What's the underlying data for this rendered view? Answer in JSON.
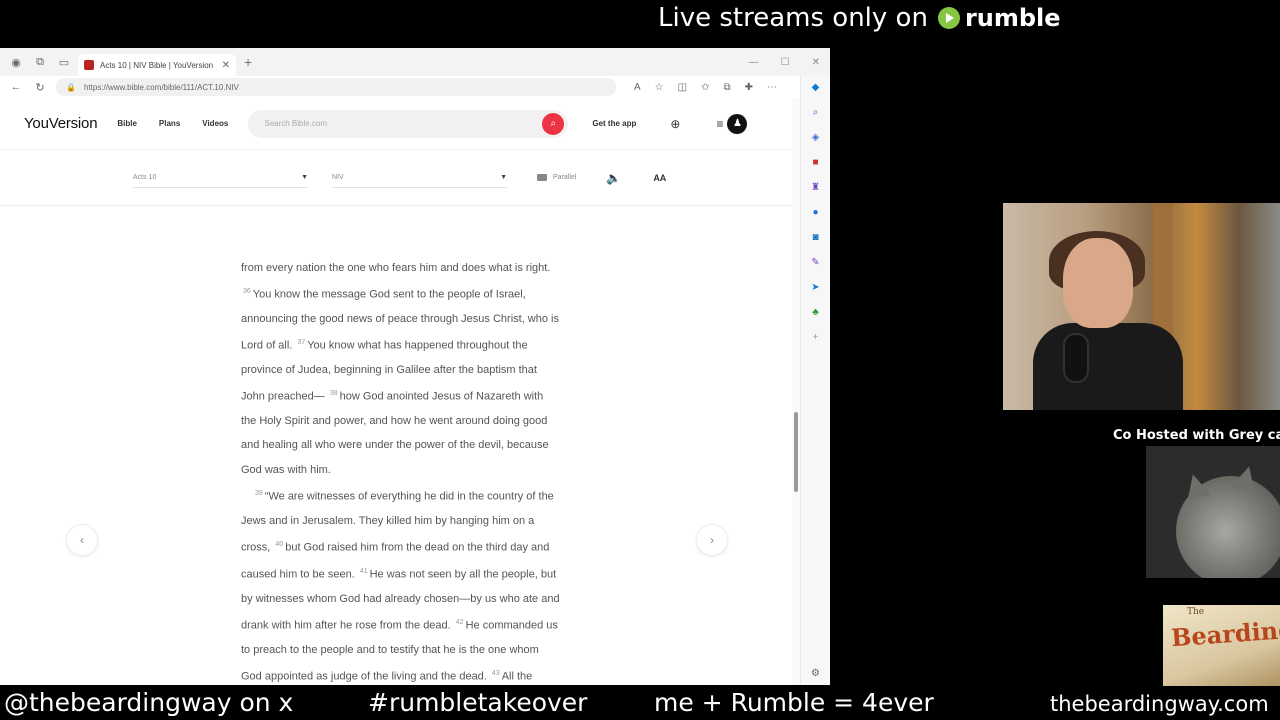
{
  "overlay": {
    "top_text": "Live streams only on",
    "rumble_word": "rumble",
    "cohost_label": "Co Hosted with Grey cat",
    "logo_small": "The",
    "logo_text": "Bearding",
    "bottom": {
      "handle": "@thebeardingway on x",
      "hashtag": "#rumbletakeover",
      "slogan": "me + Rumble = 4ever",
      "site": "thebeardingway.com"
    }
  },
  "browser": {
    "tab_title": "Acts 10 | NIV Bible | YouVersion",
    "url": "https://www.bible.com/bible/111/ACT.10.NIV"
  },
  "youversion": {
    "logo": "YouVersion",
    "nav": [
      "Bible",
      "Plans",
      "Videos"
    ],
    "search_placeholder": "Search Bible.com",
    "get_app": "Get the app",
    "book_select": "Acts 10",
    "version_select": "NIV",
    "parallel": "Parallel",
    "aa": "AA"
  },
  "reader": {
    "p1": "from every nation the one who fears him and does what is right.",
    "v36": "36",
    "t36": "You know the message God sent to the people of Israel, announcing the good news of peace through Jesus Christ, who is Lord of all.",
    "v37": "37",
    "t37": "You know what has happened throughout the province of Judea, beginning in Galilee after the baptism that John preached—",
    "v38": "38",
    "t38": "how God anointed Jesus of Nazareth with the Holy Spirit and power, and how he went around doing good and healing all who were under the power of the devil, because God was with him.",
    "v39": "39",
    "t39": "“We are witnesses of everything he did in the country of the Jews and in Jerusalem. They killed him by hanging him on a cross,",
    "v40": "40",
    "t40": "but God raised him from the dead on the third day and caused him to be seen.",
    "v41": "41",
    "t41": "He was not seen by all the people, but by witnesses whom God had already chosen—by us who ate and drank with him after he rose from the dead.",
    "v42": "42",
    "t42": "He commanded us to preach to the people and to testify that he is the one whom God appointed as judge of the living and the dead.",
    "v43": "43",
    "t43": "All the prophets testify about"
  }
}
